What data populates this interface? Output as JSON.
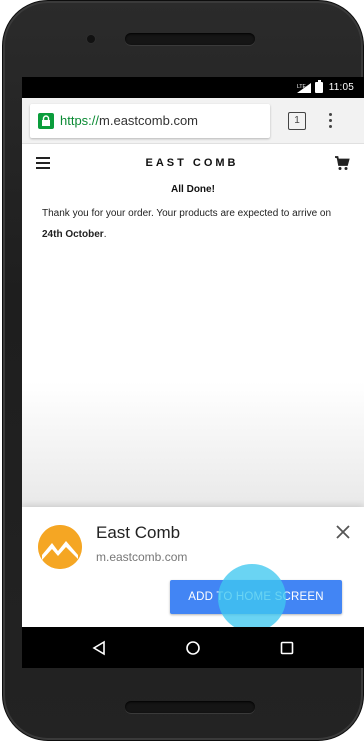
{
  "status_bar": {
    "signal": "LTE",
    "time": "11:05"
  },
  "browser": {
    "url_scheme": "https://",
    "url_host": "m.eastcomb.com",
    "tab_count": "1"
  },
  "site": {
    "title": "EAST COMB",
    "heading": "All Done!",
    "body_prefix": "Thank you for your order. Your products are expected to arrive on ",
    "body_date": "24th October",
    "body_suffix": "."
  },
  "banner": {
    "app_name": "East Comb",
    "app_url": "m.eastcomb.com",
    "button_label": "ADD TO HOME SCREEN",
    "logo_color": "#f5a623"
  },
  "colors": {
    "accent": "#4285f4",
    "secure": "#0b9d3c",
    "touch": "#40c8f0"
  }
}
